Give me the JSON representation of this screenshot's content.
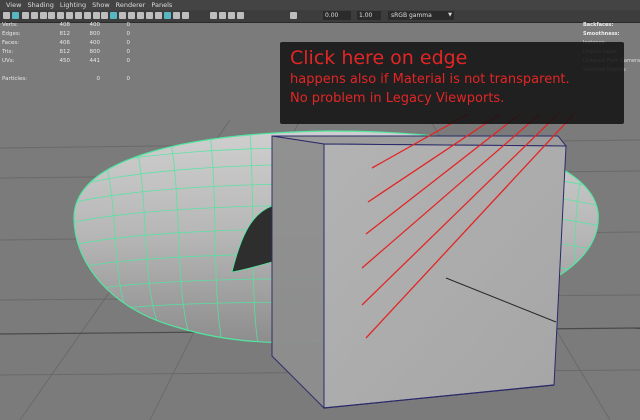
{
  "menu": [
    "View",
    "Shading",
    "Lighting",
    "Show",
    "Renderer",
    "Panels"
  ],
  "toolbar": {
    "icons": [
      "select-camera-icon",
      "camera-attributes-icon",
      "bookmark-icon",
      "image-plane-icon",
      "grid-icon",
      "film-gate-icon",
      "resolution-gate-icon",
      "gate-mask-icon",
      "field-chart-icon",
      "safe-action-icon",
      "safe-title-icon",
      "wireframe-icon",
      "smooth-shade-icon",
      "default-material-icon",
      "textured-icon",
      "use-all-lights-icon",
      "shadows-icon",
      "screen-space-ao-icon",
      "motion-blur-icon",
      "anti-aliasing-icon",
      "depth-of-field-icon",
      "isolate-select-icon",
      "xray-icon",
      "xray-joints-icon",
      "backface-culling-icon",
      "exposure-icon"
    ],
    "exposure": "0.00",
    "gamma": "1.00",
    "color_space": "sRGB gamma"
  },
  "hud_stats": [
    {
      "label": "Verts:",
      "v1": "408",
      "v2": "400",
      "v3": "0"
    },
    {
      "label": "Edges:",
      "v1": "812",
      "v2": "800",
      "v3": "0"
    },
    {
      "label": "Faces:",
      "v1": "406",
      "v2": "400",
      "v3": "0"
    },
    {
      "label": "Tris:",
      "v1": "812",
      "v2": "800",
      "v3": "0"
    },
    {
      "label": "UVs:",
      "v1": "450",
      "v2": "441",
      "v3": "0"
    },
    {
      "label": "",
      "v1": "",
      "v2": "",
      "v3": ""
    },
    {
      "label": "Particles:",
      "v1": "",
      "v2": "0",
      "v3": "0"
    }
  ],
  "hud_right": [
    "Backfaces:",
    "Smoothness:",
    "Instance:",
    "Display Layer:",
    "Distance From Camera:",
    "Selected Objects:"
  ],
  "annotation": {
    "title": "Click here on edge",
    "line2": "happens also if Material is not transparent.",
    "line3": "No problem in Legacy Viewports.",
    "color": "#e32525"
  },
  "colors": {
    "wire": "#52e6a0",
    "viewport_bg": "#7b7b7b"
  }
}
